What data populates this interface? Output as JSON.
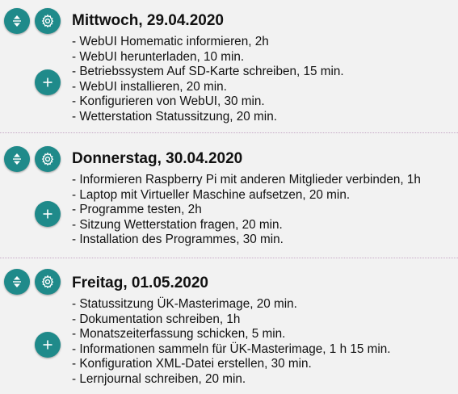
{
  "days": [
    {
      "title": "Mittwoch, 29.04.2020",
      "tasks": [
        "WebUI Homematic informieren, 2h",
        "WebUI herunterladen, 10 min.",
        "Betriebssystem Auf SD-Karte schreiben, 15 min.",
        "WebUI installieren, 20 min.",
        "Konfigurieren von WebUI, 30 min.",
        "Wetterstation Statussitzung, 20 min."
      ]
    },
    {
      "title": "Donnerstag, 30.04.2020",
      "tasks": [
        "Informieren Raspberry Pi mit anderen Mitglieder verbinden, 1h",
        "Laptop mit Virtueller Maschine aufsetzen, 20 min.",
        "Programme testen, 2h",
        "Sitzung Wetterstation fragen, 20 min.",
        "Installation des Programmes, 30 min."
      ]
    },
    {
      "title": "Freitag, 01.05.2020",
      "tasks": [
        "Statussitzung ÜK-Masterimage, 20 min.",
        "Dokumentation schreiben, 1h",
        "Monatszeiterfassung schicken, 5 min.",
        "Informationen sammeln für ÜK-Masterimage, 1 h 15 min.",
        "Konfiguration XML-Datei erstellen, 30 min.",
        "Lernjournal schreiben, 20 min."
      ]
    }
  ],
  "icons": {
    "sort": "sort-icon",
    "settings": "gear-icon",
    "add": "plus-icon"
  },
  "colors": {
    "button": "#1f8a8a",
    "background": "#f2f2f2",
    "separator": "#c6a9c6"
  }
}
